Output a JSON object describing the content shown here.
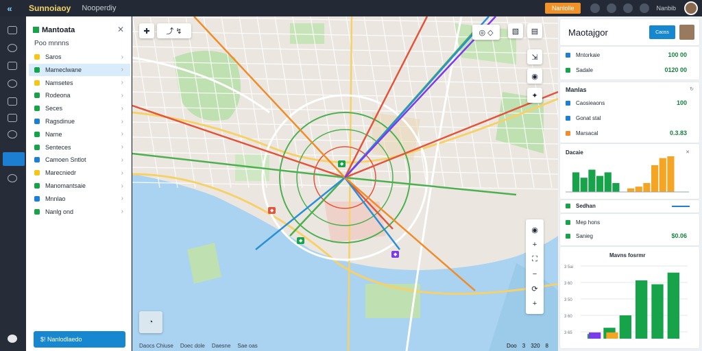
{
  "topbar": {
    "logo_glyph": "«",
    "app_title": "Sunnoiaoy",
    "crumb": "Nooperdiy",
    "cta": "Nanlolle",
    "user_label": "Nanbib"
  },
  "sidebar": {
    "title": "Mantoata",
    "subtitle": "Poo mnnns",
    "items": [
      {
        "label": "Saros",
        "color": "#f5c518",
        "selected": false
      },
      {
        "label": "Mameclwane",
        "color": "#16a34a",
        "selected": true
      },
      {
        "label": "Namsetes",
        "color": "#f5c518",
        "selected": false
      },
      {
        "label": "Rodeona",
        "color": "#16a34a",
        "selected": false
      },
      {
        "label": "Seces",
        "color": "#16a34a",
        "selected": false
      },
      {
        "label": "Ragsdinue",
        "color": "#1d7fd1",
        "selected": false
      },
      {
        "label": "Narne",
        "color": "#16a34a",
        "selected": false
      },
      {
        "label": "Senteces",
        "color": "#16a34a",
        "selected": false
      },
      {
        "label": "Camoen Sntlot",
        "color": "#1d7fd1",
        "selected": false
      },
      {
        "label": "Marecniedr",
        "color": "#f5c518",
        "selected": false
      },
      {
        "label": "Manomantsaie",
        "color": "#16a34a",
        "selected": false
      },
      {
        "label": "Mnnlao",
        "color": "#1d7fd1",
        "selected": false
      },
      {
        "label": "Nanlg ond",
        "color": "#16a34a",
        "selected": false
      }
    ],
    "button": "$! Nanlodlaedo"
  },
  "map": {
    "status_left": [
      "Daocs Chiuse",
      "Doec dole",
      "Daesne",
      "Sae oas"
    ],
    "status_right": [
      "Doo",
      "3",
      "320",
      "8"
    ]
  },
  "rpanel": {
    "title": "Maotajgor",
    "button": "Caoss",
    "card1": [
      {
        "label": "Mntorkaie",
        "value": "100 00",
        "color": "#1d7fd1"
      },
      {
        "label": "Sadale",
        "value": "0120 00",
        "color": "#16a34a"
      }
    ],
    "card2_title": "Manlas",
    "card2": [
      {
        "label": "Caosieaons",
        "value": "100",
        "color": "#1d7fd1"
      },
      {
        "label": "Gonat stal",
        "value": "",
        "color": "#1d7fd1"
      },
      {
        "label": "Marsacal",
        "value": "0.3.83",
        "color": "#f08c2a"
      }
    ],
    "card3_title": "Dacaie",
    "card4_title": "Sedhan",
    "card5": [
      {
        "label": "Mep hons",
        "value": "",
        "color": "#16a34a"
      },
      {
        "label": "Sanieg",
        "value": "$0.06",
        "color": "#16a34a"
      }
    ],
    "card6_title": "Mavns fosrmr",
    "card6_ticks": [
      "3 5ai",
      "3 60",
      "3 50",
      "3 60",
      "3 65"
    ]
  },
  "chart_data": [
    {
      "type": "bar",
      "title": "Dacaie",
      "series": [
        {
          "color": "#16a34a",
          "values": [
            22,
            16,
            25,
            18,
            22,
            10
          ]
        },
        {
          "color": "#f5a524",
          "values": [
            4,
            6,
            10,
            30,
            38,
            40
          ]
        }
      ]
    },
    {
      "type": "bar",
      "title": "Mavns fosrmr",
      "series": [
        {
          "color": "#16a34a",
          "values": [
            6,
            14,
            30,
            75,
            70,
            85
          ]
        },
        {
          "color": "#7c3aed",
          "values": [
            8,
            0,
            0,
            0,
            0,
            0
          ]
        },
        {
          "color": "#f5a524",
          "values": [
            0,
            8,
            0,
            0,
            0,
            0
          ]
        }
      ]
    }
  ]
}
